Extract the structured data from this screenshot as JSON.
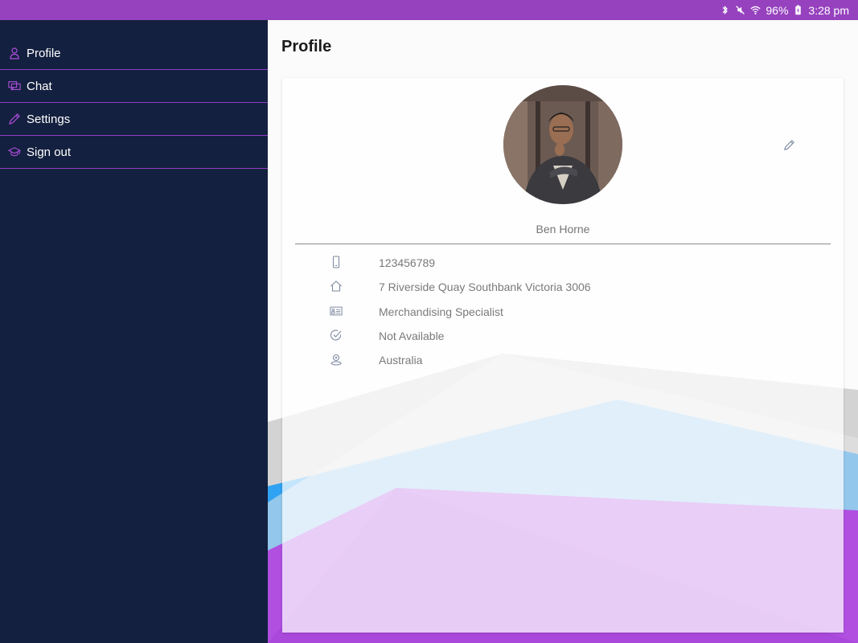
{
  "status_bar": {
    "battery": "96%",
    "time": "3:28 pm",
    "icons": [
      "bluetooth-icon",
      "mute-icon",
      "wifi-icon",
      "battery-charging-icon"
    ]
  },
  "drawer": {
    "items": [
      {
        "label": "Profile",
        "icon": "user-icon"
      },
      {
        "label": "Chat",
        "icon": "chat-icon"
      },
      {
        "label": "Settings",
        "icon": "pencil-icon"
      },
      {
        "label": "Sign out",
        "icon": "graduation-cap-icon"
      }
    ]
  },
  "page": {
    "title": "Profile"
  },
  "profile": {
    "name": "Ben Horne",
    "edit_icon": "edit-pencil-icon",
    "details": [
      {
        "icon": "mobile-phone-icon",
        "value": "123456789"
      },
      {
        "icon": "home-icon",
        "value": "7 Riverside Quay Southbank Victoria 3006"
      },
      {
        "icon": "id-card-icon",
        "value": "Merchandising Specialist"
      },
      {
        "icon": "check-circle-icon",
        "value": "Not Available"
      },
      {
        "icon": "location-pin-icon",
        "value": "Australia"
      }
    ]
  },
  "colors": {
    "status_bar": "#9642be",
    "drawer_bg": "#14203f",
    "drawer_divider": "#8e3fc4",
    "accent_purple": "#b04fe0",
    "accent_blue": "#2fa2f2",
    "text_muted": "#7a7a7a"
  }
}
